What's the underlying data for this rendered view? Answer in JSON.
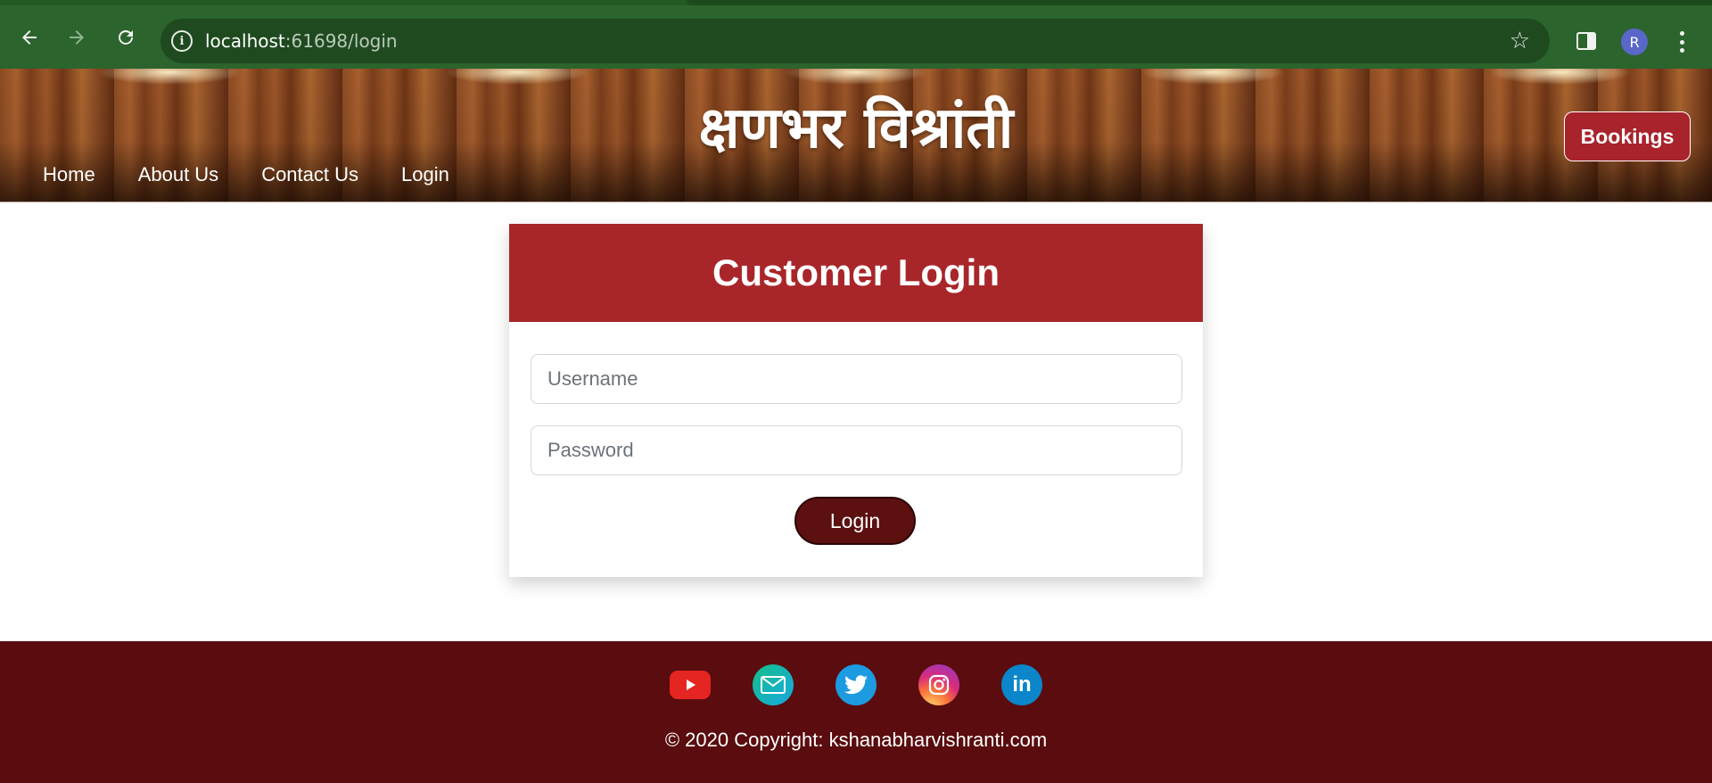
{
  "browser": {
    "url_host": "localhost",
    "url_path": ":61698/login",
    "profile_initial": "R",
    "icons": {
      "back": "arrow-left-icon",
      "forward": "arrow-right-icon",
      "reload": "reload-icon",
      "site_info": "info-icon",
      "bookmark": "star-icon",
      "side_panel": "side-panel-icon",
      "menu": "kebab-menu-icon"
    },
    "theme_color": "#2b642c"
  },
  "header": {
    "brand": "क्षणभर विश्रांती",
    "nav": [
      {
        "label": "Home"
      },
      {
        "label": "About Us"
      },
      {
        "label": "Contact Us"
      },
      {
        "label": "Login"
      }
    ],
    "bookings_label": "Bookings",
    "accent_color": "#a8232b"
  },
  "login": {
    "title": "Customer Login",
    "username_placeholder": "Username",
    "password_placeholder": "Password",
    "submit_label": "Login",
    "header_color": "#a8262a",
    "button_color": "#5c1010"
  },
  "footer": {
    "socials": [
      {
        "name": "youtube",
        "icon": "youtube-icon"
      },
      {
        "name": "email",
        "icon": "email-icon"
      },
      {
        "name": "twitter",
        "icon": "twitter-icon"
      },
      {
        "name": "instagram",
        "icon": "instagram-icon"
      },
      {
        "name": "linkedin",
        "icon": "linkedin-icon",
        "glyph": "in"
      }
    ],
    "copyright": "© 2020 Copyright: kshanabharvishranti.com",
    "background_color": "#5a0c0e"
  }
}
